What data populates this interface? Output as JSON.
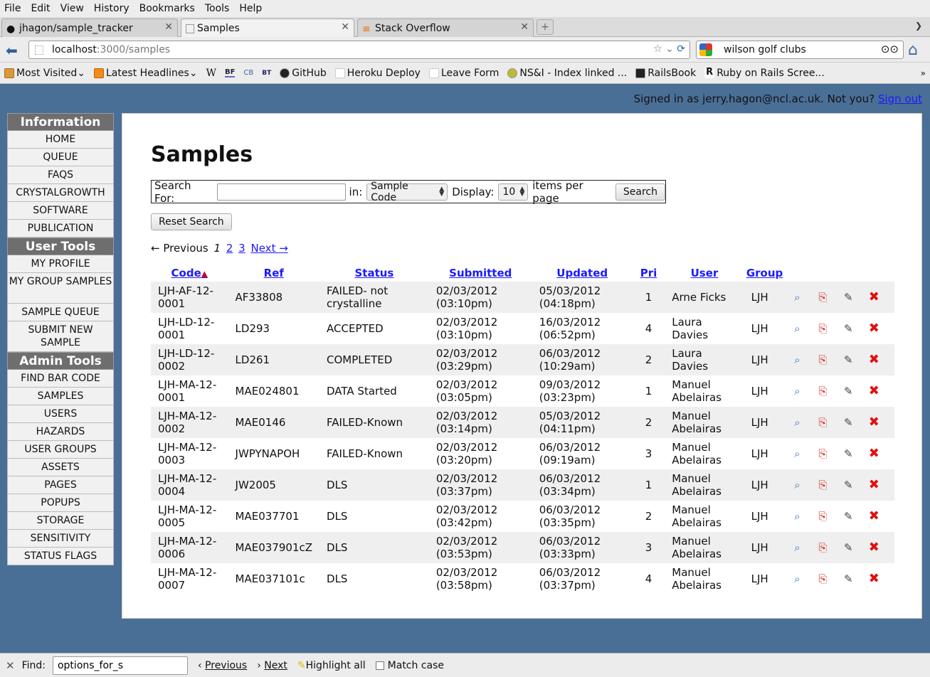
{
  "browser": {
    "menu": [
      "File",
      "Edit",
      "View",
      "History",
      "Bookmarks",
      "Tools",
      "Help"
    ],
    "tabs": [
      {
        "label": "jhagon/sample_tracker",
        "active": false
      },
      {
        "label": "Samples",
        "active": true
      },
      {
        "label": "Stack Overflow",
        "active": false
      }
    ],
    "url_host": "localhost",
    "url_path": ":3000/samples",
    "search_value": "wilson golf clubs",
    "bookmarks": [
      "Most Visited",
      "Latest Headlines",
      "W",
      "BF",
      "CB",
      "BT",
      "GitHub",
      "Heroku Deploy",
      "Leave Form",
      "NS&I - Index linked ...",
      "RailsBook",
      "Ruby on Rails Scree..."
    ]
  },
  "signin": {
    "text": "Signed in as jerry.hagon@ncl.ac.uk. Not you?",
    "link": "Sign out"
  },
  "sidebar": {
    "information_title": "Information",
    "information": [
      "HOME",
      "QUEUE",
      "FAQS",
      "CRYSTALGROWTH",
      "SOFTWARE",
      "PUBLICATION"
    ],
    "user_title": "User Tools",
    "user": [
      "MY PROFILE",
      "MY GROUP SAMPLES",
      "SAMPLE QUEUE",
      "SUBMIT NEW SAMPLE"
    ],
    "admin_title": "Admin Tools",
    "admin": [
      "FIND BAR CODE",
      "SAMPLES",
      "USERS",
      "HAZARDS",
      "USER GROUPS",
      "ASSETS",
      "PAGES",
      "POPUPS",
      "STORAGE",
      "SENSITIVITY",
      "STATUS FLAGS"
    ]
  },
  "page": {
    "title": "Samples",
    "search_for_label": "Search For:",
    "search_value": "",
    "in_label": "in:",
    "in_select": "Sample Code",
    "display_label": "Display:",
    "display_select": "10",
    "items_per_page": "items per page",
    "search_button": "Search",
    "reset_button": "Reset Search",
    "pager": {
      "prev": "← Previous",
      "current": "1",
      "pages": [
        "2",
        "3"
      ],
      "next": "Next →"
    }
  },
  "table": {
    "headers": [
      "Code",
      "Ref",
      "Status",
      "Submitted",
      "Updated",
      "Pri",
      "User",
      "Group"
    ],
    "rows": [
      {
        "code": "LJH-AF-12-0001",
        "ref": "AF33808",
        "status": "FAILED- not crystalline",
        "submitted": "02/03/2012 (03:10pm)",
        "updated": "05/03/2012 (04:18pm)",
        "pri": "1",
        "user": "Arne Ficks",
        "group": "LJH"
      },
      {
        "code": "LJH-LD-12-0001",
        "ref": "LD293",
        "status": "ACCEPTED",
        "submitted": "02/03/2012 (03:10pm)",
        "updated": "16/03/2012 (06:52pm)",
        "pri": "4",
        "user": "Laura Davies",
        "group": "LJH"
      },
      {
        "code": "LJH-LD-12-0002",
        "ref": "LD261",
        "status": "COMPLETED",
        "submitted": "02/03/2012 (03:29pm)",
        "updated": "06/03/2012 (10:29am)",
        "pri": "2",
        "user": "Laura Davies",
        "group": "LJH"
      },
      {
        "code": "LJH-MA-12-0001",
        "ref": "MAE024801",
        "status": "DATA Started",
        "submitted": "02/03/2012 (03:05pm)",
        "updated": "09/03/2012 (03:23pm)",
        "pri": "1",
        "user": "Manuel Abelairas",
        "group": "LJH"
      },
      {
        "code": "LJH-MA-12-0002",
        "ref": "MAE0146",
        "status": "FAILED-Known",
        "submitted": "02/03/2012 (03:14pm)",
        "updated": "05/03/2012 (04:11pm)",
        "pri": "2",
        "user": "Manuel Abelairas",
        "group": "LJH"
      },
      {
        "code": "LJH-MA-12-0003",
        "ref": "JWPYNAPOH",
        "status": "FAILED-Known",
        "submitted": "02/03/2012 (03:20pm)",
        "updated": "06/03/2012 (09:19am)",
        "pri": "3",
        "user": "Manuel Abelairas",
        "group": "LJH"
      },
      {
        "code": "LJH-MA-12-0004",
        "ref": "JW2005",
        "status": "DLS",
        "submitted": "02/03/2012 (03:37pm)",
        "updated": "06/03/2012 (03:34pm)",
        "pri": "1",
        "user": "Manuel Abelairas",
        "group": "LJH"
      },
      {
        "code": "LJH-MA-12-0005",
        "ref": "MAE037701",
        "status": "DLS",
        "submitted": "02/03/2012 (03:42pm)",
        "updated": "06/03/2012 (03:35pm)",
        "pri": "2",
        "user": "Manuel Abelairas",
        "group": "LJH"
      },
      {
        "code": "LJH-MA-12-0006",
        "ref": "MAE037901cZ",
        "status": "DLS",
        "submitted": "02/03/2012 (03:53pm)",
        "updated": "06/03/2012 (03:33pm)",
        "pri": "3",
        "user": "Manuel Abelairas",
        "group": "LJH"
      },
      {
        "code": "LJH-MA-12-0007",
        "ref": "MAE037101c",
        "status": "DLS",
        "submitted": "02/03/2012 (03:58pm)",
        "updated": "06/03/2012 (03:37pm)",
        "pri": "4",
        "user": "Manuel Abelairas",
        "group": "LJH"
      }
    ]
  },
  "findbar": {
    "label": "Find:",
    "value": "options_for_s",
    "previous": "Previous",
    "next": "Next",
    "highlight": "Highlight all",
    "match_case": "Match case"
  },
  "colors": {
    "page_bg": "#4a6f96",
    "link": "#1a1aff",
    "delete": "#e01010",
    "pdf": "#d42a1e"
  }
}
